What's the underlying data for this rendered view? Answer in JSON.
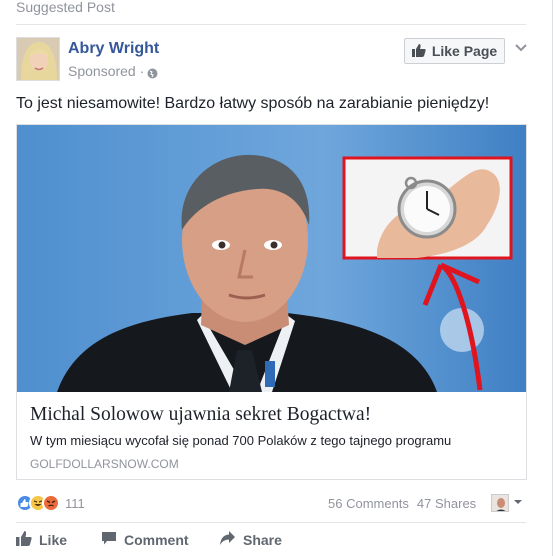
{
  "header": {
    "suggested_label": "Suggested Post"
  },
  "post": {
    "author": "Abry Wright",
    "sponsored": "Sponsored ·",
    "text": "To jest niesamowite! Bardzo łatwy sposób na zarabianie pieniędzy!",
    "like_page_label": "Like Page"
  },
  "link_preview": {
    "title": "Michal Solowow ujawnia sekret Bogactwa!",
    "description": "W tym miesiącu wycofał się ponad 700 Polaków z tego tajnego programu",
    "domain": "GOLFDOLLARSNOW.COM"
  },
  "stats": {
    "reaction_count": "111",
    "comments": "56 Comments",
    "shares": "47 Shares"
  },
  "actions": {
    "like": "Like",
    "comment": "Comment",
    "share": "Share"
  },
  "colors": {
    "brand": "#365899",
    "muted": "#90949c",
    "highlight_red": "#e0141e"
  },
  "icons": [
    "globe-icon",
    "thumbs-up-icon",
    "chevron-down-icon",
    "haha-reaction-icon",
    "angry-reaction-icon",
    "comment-icon",
    "share-icon"
  ]
}
